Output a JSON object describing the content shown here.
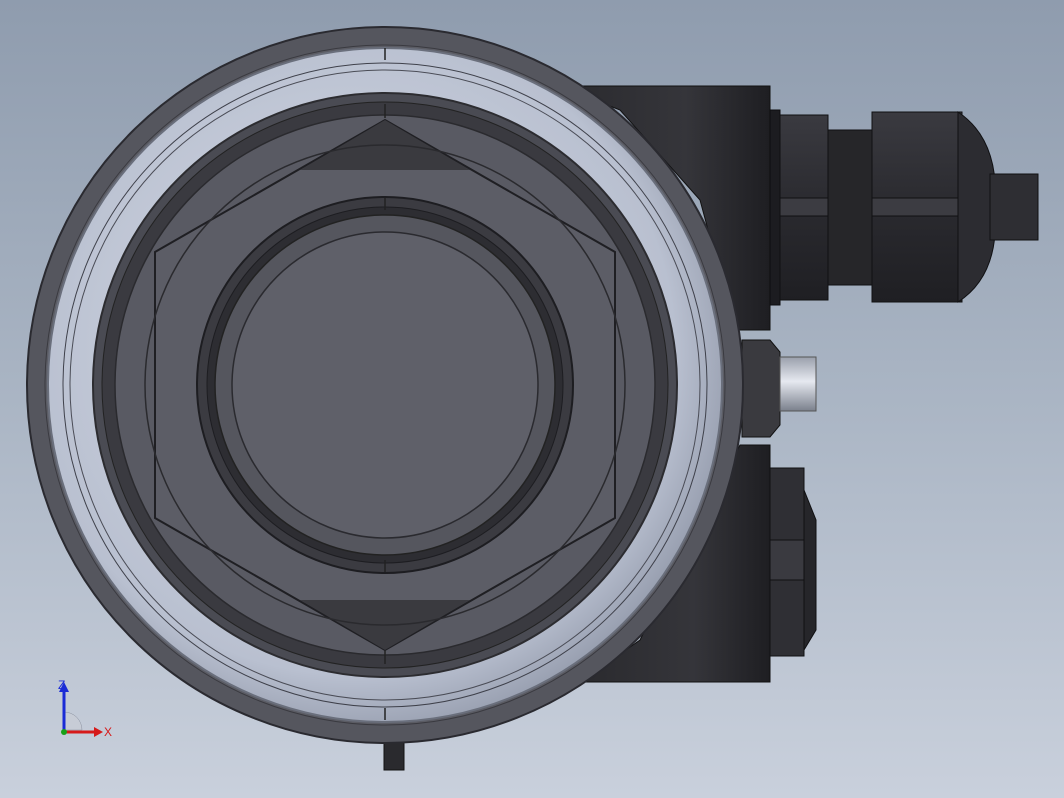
{
  "viewport": {
    "background_top": "#8f9cae",
    "background_bottom": "#c9d0dc"
  },
  "model": {
    "body_color": "#5a5b64",
    "dark_color": "#2c2c30",
    "ring_color": "#c4cad8",
    "face_color": "#5f6069",
    "label": "transmitter-housing-top-view"
  },
  "triad": {
    "z_label": "Z",
    "x_label": "X",
    "z_color": "#1a2bd6",
    "x_color": "#d61a1a",
    "y_color": "#18a018"
  }
}
